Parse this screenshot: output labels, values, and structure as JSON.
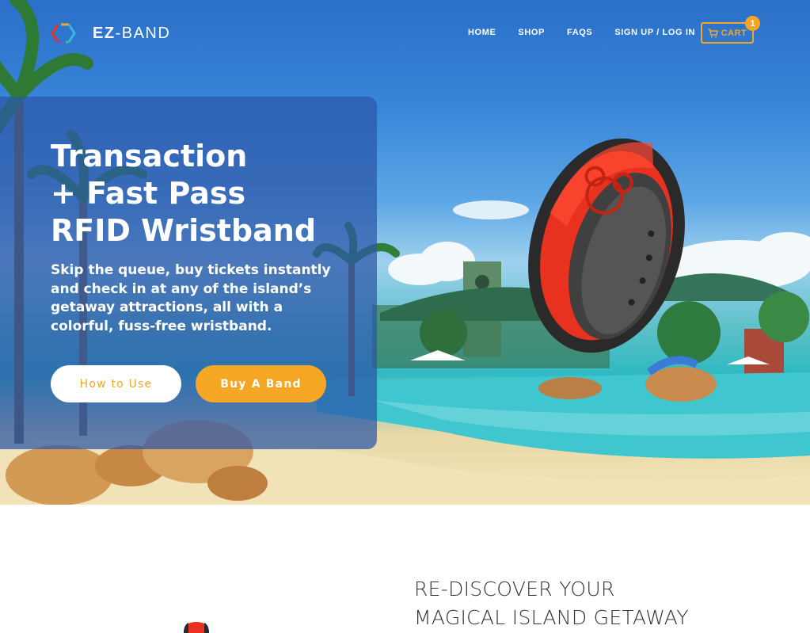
{
  "brand": {
    "name_bold": "EZ",
    "name_light": "-BAND"
  },
  "nav": {
    "links": [
      "HOME",
      "SHOP",
      "FAQS",
      "SIGN UP / LOG IN"
    ],
    "cart_label": "CART",
    "cart_count": "1"
  },
  "hero": {
    "title_lines": [
      "Transaction",
      "+ Fast Pass",
      "RFID Wristband"
    ],
    "description": "Skip the queue, buy tickets instantly and check in at any  of the island’s getaway attractions, all with a colorful, fuss-free wristband.",
    "how_to_use_label": "How to Use",
    "buy_label": "Buy A Band"
  },
  "section2": {
    "title_lines": [
      "RE-DISCOVER YOUR",
      "MAGICAL ISLAND GETAWAY"
    ]
  },
  "icons": {
    "logo": "hexagon-logo-icon",
    "cart": "shopping-cart-icon",
    "wristband": "wristband-illustration"
  },
  "colors": {
    "accent": "#f5a623",
    "hero_card": "#2b56a8",
    "band_red": "#e8321f"
  }
}
